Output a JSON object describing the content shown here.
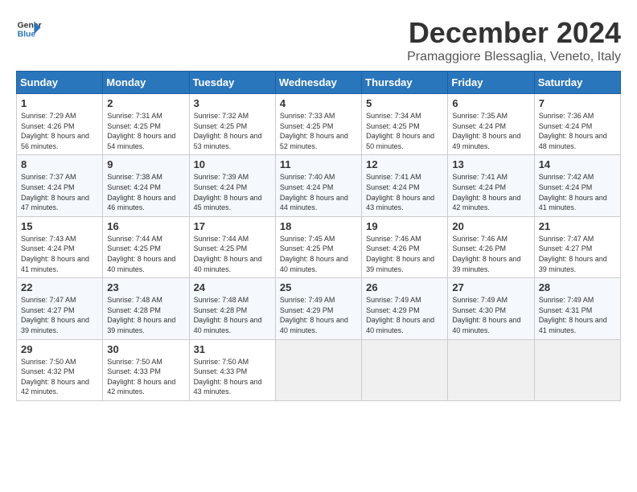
{
  "header": {
    "logo_line1": "General",
    "logo_line2": "Blue",
    "month_title": "December 2024",
    "location": "Pramaggiore Blessaglia, Veneto, Italy"
  },
  "weekdays": [
    "Sunday",
    "Monday",
    "Tuesday",
    "Wednesday",
    "Thursday",
    "Friday",
    "Saturday"
  ],
  "weeks": [
    [
      {
        "day": "1",
        "sunrise": "7:29 AM",
        "sunset": "4:26 PM",
        "daylight": "8 hours and 56 minutes."
      },
      {
        "day": "2",
        "sunrise": "7:31 AM",
        "sunset": "4:25 PM",
        "daylight": "8 hours and 54 minutes."
      },
      {
        "day": "3",
        "sunrise": "7:32 AM",
        "sunset": "4:25 PM",
        "daylight": "8 hours and 53 minutes."
      },
      {
        "day": "4",
        "sunrise": "7:33 AM",
        "sunset": "4:25 PM",
        "daylight": "8 hours and 52 minutes."
      },
      {
        "day": "5",
        "sunrise": "7:34 AM",
        "sunset": "4:25 PM",
        "daylight": "8 hours and 50 minutes."
      },
      {
        "day": "6",
        "sunrise": "7:35 AM",
        "sunset": "4:24 PM",
        "daylight": "8 hours and 49 minutes."
      },
      {
        "day": "7",
        "sunrise": "7:36 AM",
        "sunset": "4:24 PM",
        "daylight": "8 hours and 48 minutes."
      }
    ],
    [
      {
        "day": "8",
        "sunrise": "7:37 AM",
        "sunset": "4:24 PM",
        "daylight": "8 hours and 47 minutes."
      },
      {
        "day": "9",
        "sunrise": "7:38 AM",
        "sunset": "4:24 PM",
        "daylight": "8 hours and 46 minutes."
      },
      {
        "day": "10",
        "sunrise": "7:39 AM",
        "sunset": "4:24 PM",
        "daylight": "8 hours and 45 minutes."
      },
      {
        "day": "11",
        "sunrise": "7:40 AM",
        "sunset": "4:24 PM",
        "daylight": "8 hours and 44 minutes."
      },
      {
        "day": "12",
        "sunrise": "7:41 AM",
        "sunset": "4:24 PM",
        "daylight": "8 hours and 43 minutes."
      },
      {
        "day": "13",
        "sunrise": "7:41 AM",
        "sunset": "4:24 PM",
        "daylight": "8 hours and 42 minutes."
      },
      {
        "day": "14",
        "sunrise": "7:42 AM",
        "sunset": "4:24 PM",
        "daylight": "8 hours and 41 minutes."
      }
    ],
    [
      {
        "day": "15",
        "sunrise": "7:43 AM",
        "sunset": "4:24 PM",
        "daylight": "8 hours and 41 minutes."
      },
      {
        "day": "16",
        "sunrise": "7:44 AM",
        "sunset": "4:25 PM",
        "daylight": "8 hours and 40 minutes."
      },
      {
        "day": "17",
        "sunrise": "7:44 AM",
        "sunset": "4:25 PM",
        "daylight": "8 hours and 40 minutes."
      },
      {
        "day": "18",
        "sunrise": "7:45 AM",
        "sunset": "4:25 PM",
        "daylight": "8 hours and 40 minutes."
      },
      {
        "day": "19",
        "sunrise": "7:46 AM",
        "sunset": "4:26 PM",
        "daylight": "8 hours and 39 minutes."
      },
      {
        "day": "20",
        "sunrise": "7:46 AM",
        "sunset": "4:26 PM",
        "daylight": "8 hours and 39 minutes."
      },
      {
        "day": "21",
        "sunrise": "7:47 AM",
        "sunset": "4:27 PM",
        "daylight": "8 hours and 39 minutes."
      }
    ],
    [
      {
        "day": "22",
        "sunrise": "7:47 AM",
        "sunset": "4:27 PM",
        "daylight": "8 hours and 39 minutes."
      },
      {
        "day": "23",
        "sunrise": "7:48 AM",
        "sunset": "4:28 PM",
        "daylight": "8 hours and 39 minutes."
      },
      {
        "day": "24",
        "sunrise": "7:48 AM",
        "sunset": "4:28 PM",
        "daylight": "8 hours and 40 minutes."
      },
      {
        "day": "25",
        "sunrise": "7:49 AM",
        "sunset": "4:29 PM",
        "daylight": "8 hours and 40 minutes."
      },
      {
        "day": "26",
        "sunrise": "7:49 AM",
        "sunset": "4:29 PM",
        "daylight": "8 hours and 40 minutes."
      },
      {
        "day": "27",
        "sunrise": "7:49 AM",
        "sunset": "4:30 PM",
        "daylight": "8 hours and 40 minutes."
      },
      {
        "day": "28",
        "sunrise": "7:49 AM",
        "sunset": "4:31 PM",
        "daylight": "8 hours and 41 minutes."
      }
    ],
    [
      {
        "day": "29",
        "sunrise": "7:50 AM",
        "sunset": "4:32 PM",
        "daylight": "8 hours and 42 minutes."
      },
      {
        "day": "30",
        "sunrise": "7:50 AM",
        "sunset": "4:33 PM",
        "daylight": "8 hours and 42 minutes."
      },
      {
        "day": "31",
        "sunrise": "7:50 AM",
        "sunset": "4:33 PM",
        "daylight": "8 hours and 43 minutes."
      },
      null,
      null,
      null,
      null
    ]
  ]
}
